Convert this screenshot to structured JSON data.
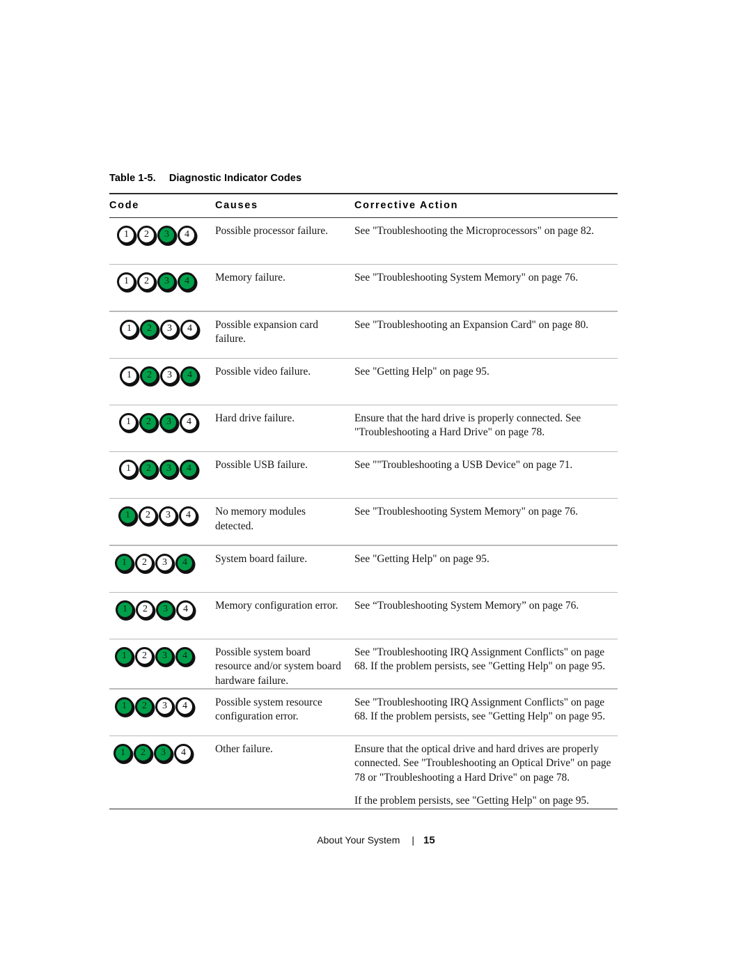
{
  "table": {
    "number_label": "Table 1-5.",
    "caption": "Diagnostic Indicator Codes",
    "headers": {
      "code": "Code",
      "causes": "Causes",
      "action": "Corrective Action"
    },
    "led_labels": [
      "1",
      "2",
      "3",
      "4"
    ],
    "led_on_color": "#00a04b",
    "led_off_color": "#ffffff",
    "rows": [
      {
        "leds": [
          false,
          false,
          true,
          false
        ],
        "cause": "Possible processor failure.",
        "action": [
          "See \"Troubleshooting the Microprocessors\" on page 82."
        ],
        "offset": 11
      },
      {
        "leds": [
          false,
          false,
          true,
          true
        ],
        "cause": "Memory failure.",
        "action": [
          "See \"Troubleshooting System Memory\" on page 76."
        ],
        "offset": 11
      },
      {
        "leds": [
          false,
          true,
          false,
          false
        ],
        "cause": "Possible expansion card failure.",
        "action": [
          "See \"Troubleshooting an Expansion Card\" on page 80."
        ],
        "offset": 15
      },
      {
        "leds": [
          false,
          true,
          false,
          true
        ],
        "cause": "Possible video failure.",
        "action": [
          "See \"Getting Help\" on page 95."
        ],
        "offset": 15
      },
      {
        "leds": [
          false,
          true,
          true,
          false
        ],
        "cause": "Hard drive failure.",
        "action": [
          "Ensure that the hard drive is properly connected. See \"Troubleshooting a Hard Drive\" on page 78."
        ],
        "offset": 14
      },
      {
        "leds": [
          false,
          true,
          true,
          true
        ],
        "cause": "Possible USB failure.",
        "action": [
          "See \"\"Troubleshooting a USB Device\" on page 71."
        ],
        "offset": 14
      },
      {
        "leds": [
          true,
          false,
          false,
          false
        ],
        "cause": "No memory modules detected.",
        "action": [
          "See \"Troubleshooting System Memory\" on page 76."
        ],
        "offset": 13
      },
      {
        "leds": [
          true,
          false,
          false,
          true
        ],
        "cause": "System board failure.",
        "action": [
          "See \"Getting Help\" on page 95."
        ],
        "offset": 8
      },
      {
        "leds": [
          true,
          false,
          true,
          false
        ],
        "cause": "Memory configuration error.",
        "action": [
          "See “Troubleshooting System Memory” on page 76."
        ],
        "offset": 9
      },
      {
        "leds": [
          true,
          false,
          true,
          true
        ],
        "cause": "Possible system board resource and/or system board hardware failure.",
        "action": [
          "See \"Troubleshooting IRQ Assignment Conflicts\" on page 68. If the problem persists, see \"Getting Help\" on page 95."
        ],
        "offset": 8
      },
      {
        "leds": [
          true,
          true,
          false,
          false
        ],
        "cause": "Possible system resource configuration error.",
        "action": [
          "See \"Troubleshooting IRQ Assignment Conflicts\" on page 68. If the problem persists, see \"Getting Help\" on page 95."
        ],
        "offset": 8
      },
      {
        "leds": [
          true,
          true,
          true,
          false
        ],
        "cause": "Other failure.",
        "action": [
          "Ensure that the optical drive and hard drives are properly connected. See \"Troubleshooting an Optical Drive\" on page 78 or \"Troubleshooting a Hard Drive\" on page 78.",
          "If the problem persists, see \"Getting Help\" on page 95."
        ],
        "offset": 6
      }
    ]
  },
  "footer": {
    "section": "About Your System",
    "separator": "|",
    "page_number": "15"
  }
}
